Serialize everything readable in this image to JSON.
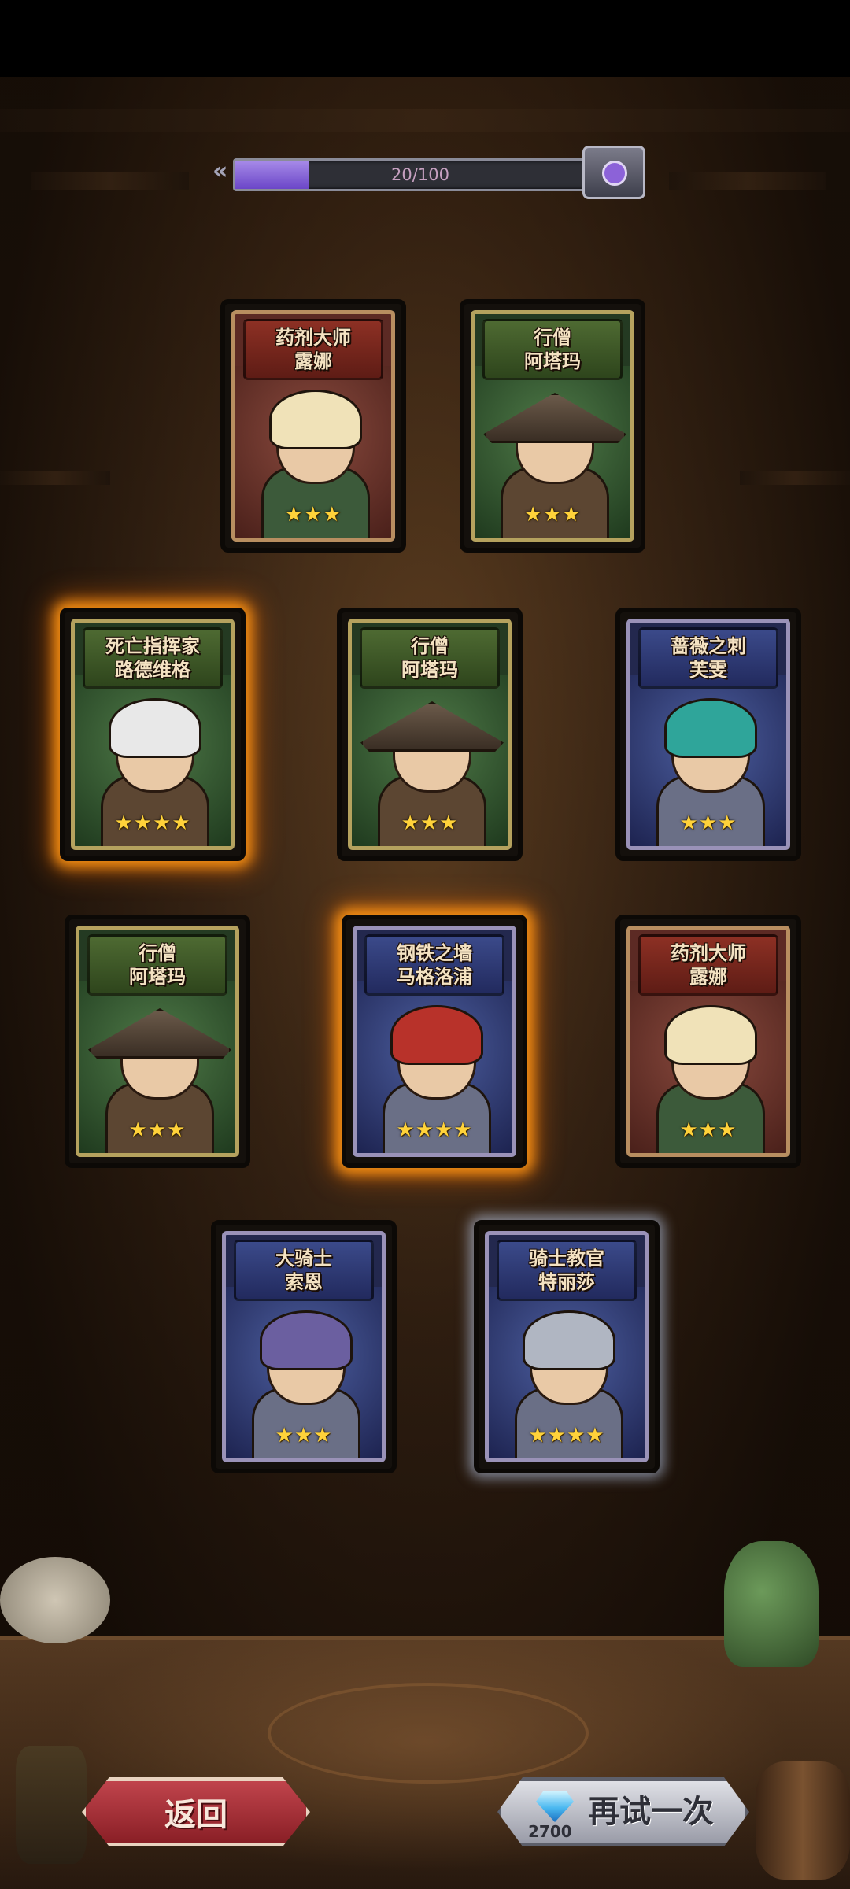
{
  "progress": {
    "text": "20/100",
    "fraction": 0.2
  },
  "cards": [
    {
      "name1": "药剂大师",
      "name2": "露娜",
      "stars": "★★★",
      "palette": "red",
      "glow": "none",
      "icon": "alchemist-portrait-icon"
    },
    {
      "name1": "行僧",
      "name2": "阿塔玛",
      "stars": "★★★",
      "palette": "green",
      "glow": "none",
      "icon": "monk-portrait-icon"
    },
    {
      "name1": "死亡指挥家",
      "name2": "路德维格",
      "stars": "★★★★",
      "palette": "green",
      "glow": "gold",
      "icon": "death-conductor-portrait-icon"
    },
    {
      "name1": "行僧",
      "name2": "阿塔玛",
      "stars": "★★★",
      "palette": "green",
      "glow": "none",
      "icon": "monk-portrait-icon"
    },
    {
      "name1": "蔷薇之刺",
      "name2": "芙雯",
      "stars": "★★★",
      "palette": "blue",
      "glow": "none",
      "icon": "rose-thorn-portrait-icon"
    },
    {
      "name1": "行僧",
      "name2": "阿塔玛",
      "stars": "★★★",
      "palette": "green",
      "glow": "none",
      "icon": "monk-portrait-icon"
    },
    {
      "name1": "钢铁之墙",
      "name2": "马格洛浦",
      "stars": "★★★★",
      "palette": "blue",
      "glow": "gold",
      "icon": "iron-wall-portrait-icon"
    },
    {
      "name1": "药剂大师",
      "name2": "露娜",
      "stars": "★★★",
      "palette": "red",
      "glow": "none",
      "icon": "alchemist-portrait-icon"
    },
    {
      "name1": "大骑士",
      "name2": "索恩",
      "stars": "★★★",
      "palette": "blue",
      "glow": "none",
      "icon": "grand-knight-portrait-icon"
    },
    {
      "name1": "骑士教官",
      "name2": "特丽莎",
      "stars": "★★★★",
      "palette": "blue",
      "glow": "silver",
      "icon": "knight-instructor-portrait-icon"
    }
  ],
  "buttons": {
    "back": {
      "label": "返回"
    },
    "retry": {
      "label": "再试一次",
      "cost": "2700",
      "icon": "diamond-gem-icon"
    }
  },
  "colors": {
    "glow_gold": "#ff9a14",
    "progress_fill": "#7b56d4",
    "back_button": "#a8323a",
    "retry_button": "#c8c9d2"
  }
}
